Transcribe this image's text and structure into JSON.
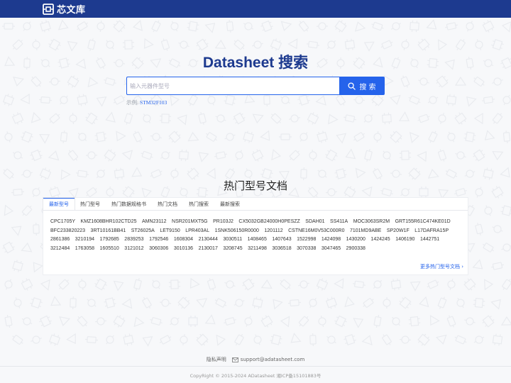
{
  "header": {
    "logo_text": "芯文库",
    "bg_color": "#1d3a8f"
  },
  "hero": {
    "title": "Datasheet 搜索",
    "search_placeholder": "输入元器件型号",
    "search_button": "搜 索",
    "example_label": "示例:",
    "example_value": "STM32F103"
  },
  "section": {
    "title": "热门型号文档",
    "tabs": [
      "最新型号",
      "热门型号",
      "热门数据规格书",
      "热门文档",
      "热门搜索",
      "最新搜索"
    ],
    "active_tab": 0,
    "parts": [
      "CPC1705Y",
      "KMZ1608BHR102CTD25",
      "AMN23112",
      "NSR201MXT5G",
      "PR103J2",
      "CX5032GB24000H0PESZZ",
      "SDAH01",
      "SS411A",
      "MOC3063SR2M",
      "GRT155R61C474KE01D",
      "BFC233820223",
      "3RT10161BB41",
      "ST26025A",
      "LET9150",
      "LPR403AL",
      "1SNK506150R0000",
      "1201112",
      "CSTNE16M0V53C000R0",
      "7101MD9ABE",
      "SP20W1F",
      "L17DAFRA15P",
      "2861386",
      "3210194",
      "1792685",
      "2839253",
      "1792546",
      "1608304",
      "2130444",
      "3030511",
      "1408465",
      "1407643",
      "1522998",
      "1424098",
      "1430200",
      "1424245",
      "1406190",
      "1442751",
      "3212484",
      "1763058",
      "1605510",
      "3121012",
      "3060306",
      "3010136",
      "2130017",
      "3208745",
      "3211498",
      "3036518",
      "3070338",
      "3047465",
      "2900338"
    ],
    "more_link": "更多热门型号文档"
  },
  "footer": {
    "privacy": "隐私声明",
    "email": "support@adatasheet.com",
    "copyright": "CopyRight © 2015-2024 ADatasheet 湘ICP备15101883号"
  },
  "colors": {
    "brand_blue": "#1d3a8f",
    "accent": "#2563eb"
  }
}
